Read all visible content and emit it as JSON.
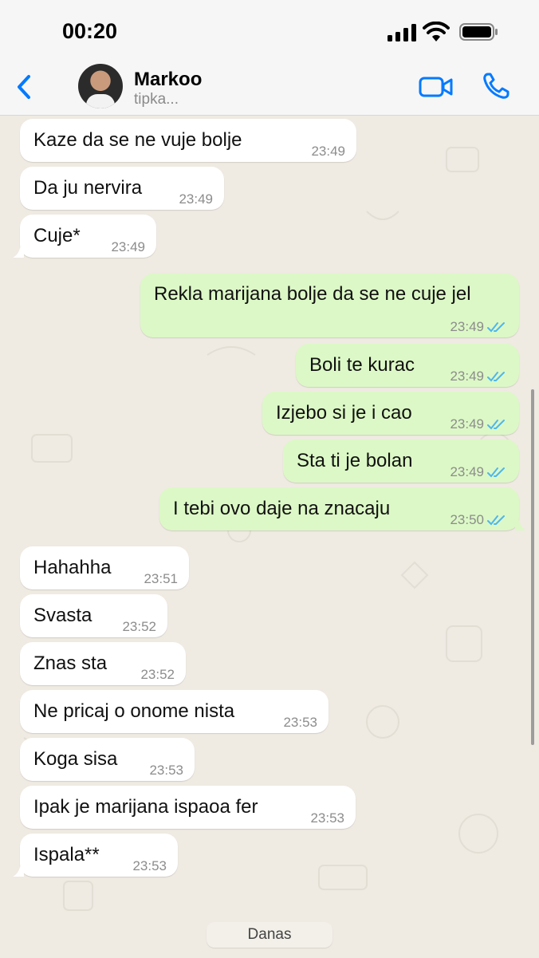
{
  "status_bar": {
    "time": "00:20"
  },
  "header": {
    "contact_name": "Markoo",
    "contact_status": "tipka..."
  },
  "colors": {
    "accent": "#007aff",
    "incoming_bubble": "#ffffff",
    "outgoing_bubble": "#dcf8c6",
    "read_ticks": "#4fb6ec",
    "background": "#efeae2"
  },
  "icons": {
    "back": "chevron-left-icon",
    "video": "video-camera-icon",
    "call": "phone-icon",
    "read_receipt": "double-check-icon"
  },
  "messages": [
    {
      "direction": "in",
      "text": "Kaze da se ne vuje bolje",
      "time": "23:49"
    },
    {
      "direction": "in",
      "text": "Da ju nervira",
      "time": "23:49"
    },
    {
      "direction": "in",
      "text": "Cuje*",
      "time": "23:49"
    },
    {
      "direction": "out",
      "text": "Rekla marijana bolje da se ne cuje jel",
      "time": "23:49",
      "read": true
    },
    {
      "direction": "out",
      "text": "Boli te kurac",
      "time": "23:49",
      "read": true
    },
    {
      "direction": "out",
      "text": "Izjebo si je i cao",
      "time": "23:49",
      "read": true
    },
    {
      "direction": "out",
      "text": "Sta ti je bolan",
      "time": "23:49",
      "read": true
    },
    {
      "direction": "out",
      "text": "I tebi ovo daje na znacaju",
      "time": "23:50",
      "read": true
    },
    {
      "direction": "in",
      "text": "Hahahha",
      "time": "23:51"
    },
    {
      "direction": "in",
      "text": "Svasta",
      "time": "23:52"
    },
    {
      "direction": "in",
      "text": "Znas sta",
      "time": "23:52"
    },
    {
      "direction": "in",
      "text": "Ne pricaj o onome nista",
      "time": "23:53"
    },
    {
      "direction": "in",
      "text": "Koga sisa",
      "time": "23:53"
    },
    {
      "direction": "in",
      "text": "Ipak je marijana ispaoa fer",
      "time": "23:53"
    },
    {
      "direction": "in",
      "text": "Ispala**",
      "time": "23:53"
    }
  ],
  "date_separator": "Danas"
}
